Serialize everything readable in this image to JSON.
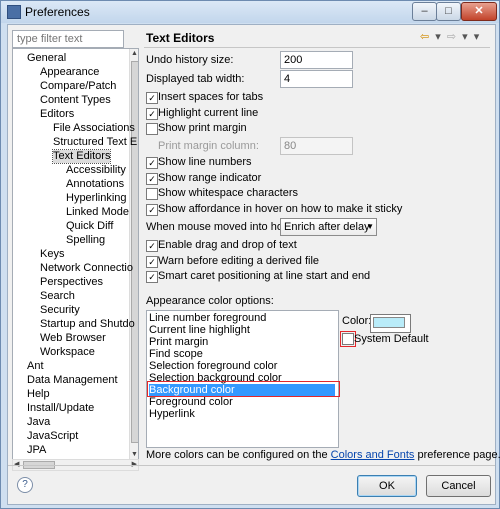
{
  "window": {
    "title": "Preferences",
    "min_glyph": "–",
    "max_glyph": "□",
    "close_glyph": "✕"
  },
  "sidebar": {
    "filter_placeholder": "type filter text",
    "items": [
      {
        "label": "General",
        "level": 0
      },
      {
        "label": "Appearance",
        "level": 1
      },
      {
        "label": "Compare/Patch",
        "level": 1
      },
      {
        "label": "Content Types",
        "level": 1
      },
      {
        "label": "Editors",
        "level": 1
      },
      {
        "label": "File Associations",
        "level": 2
      },
      {
        "label": "Structured Text E",
        "level": 2
      },
      {
        "label": "Text Editors",
        "level": 2,
        "selected": true
      },
      {
        "label": "Accessibility",
        "level": 3
      },
      {
        "label": "Annotations",
        "level": 3
      },
      {
        "label": "Hyperlinking",
        "level": 3
      },
      {
        "label": "Linked Mode",
        "level": 3
      },
      {
        "label": "Quick Diff",
        "level": 3
      },
      {
        "label": "Spelling",
        "level": 3
      },
      {
        "label": "Keys",
        "level": 1
      },
      {
        "label": "Network Connectio",
        "level": 1
      },
      {
        "label": "Perspectives",
        "level": 1
      },
      {
        "label": "Search",
        "level": 1
      },
      {
        "label": "Security",
        "level": 1
      },
      {
        "label": "Startup and Shutdo",
        "level": 1
      },
      {
        "label": "Web Browser",
        "level": 1
      },
      {
        "label": "Workspace",
        "level": 1
      },
      {
        "label": "Ant",
        "level": 0
      },
      {
        "label": "Data Management",
        "level": 0
      },
      {
        "label": "Help",
        "level": 0
      },
      {
        "label": "Install/Update",
        "level": 0
      },
      {
        "label": "Java",
        "level": 0
      },
      {
        "label": "JavaScript",
        "level": 0
      },
      {
        "label": "JPA",
        "level": 0
      }
    ]
  },
  "page": {
    "title": "Text Editors",
    "nav_back": "⇦",
    "nav_fwd": "⇨",
    "nav_menu": "▾",
    "undo_label": "Undo history size:",
    "undo_value": "200",
    "tab_label": "Displayed tab width:",
    "tab_value": "4",
    "checkboxes": [
      {
        "label": "Insert spaces for tabs",
        "checked": true
      },
      {
        "label": "Highlight current line",
        "checked": true
      },
      {
        "label": "Show print margin",
        "checked": false
      }
    ],
    "print_margin_label": "Print margin column:",
    "print_margin_value": "80",
    "checkboxes2": [
      {
        "label": "Show line numbers",
        "checked": true
      },
      {
        "label": "Show range indicator",
        "checked": true
      },
      {
        "label": "Show whitespace characters",
        "checked": false
      },
      {
        "label": "Show affordance in hover on how to make it sticky",
        "checked": true
      }
    ],
    "hover_label": "When mouse moved into hover:",
    "hover_value": "Enrich after delay",
    "checkboxes3": [
      {
        "label": "Enable drag and drop of text",
        "checked": true
      },
      {
        "label": "Warn before editing a derived file",
        "checked": true
      },
      {
        "label": "Smart caret positioning at line start and end",
        "checked": true
      }
    ],
    "appearance_label": "Appearance color options:",
    "color_options": [
      "Line number foreground",
      "Current line highlight",
      "Print margin",
      "Find scope",
      "Selection foreground color",
      "Selection background color",
      "Background color",
      "Foreground color",
      "Hyperlink"
    ],
    "color_selected_index": 6,
    "color_label": "Color:",
    "color_value": "#b9ecf9",
    "system_default_label": "System Default",
    "system_default_checked": false,
    "more_prefix": "More colors can be configured on the ",
    "more_link": "Colors and Fonts",
    "more_suffix": " preference page."
  },
  "footer": {
    "help_glyph": "?",
    "ok_label": "OK",
    "cancel_label": "Cancel"
  },
  "colors": {
    "selection": "#3399ff",
    "highlight_box": "#e2272b",
    "link": "#0645ad"
  }
}
